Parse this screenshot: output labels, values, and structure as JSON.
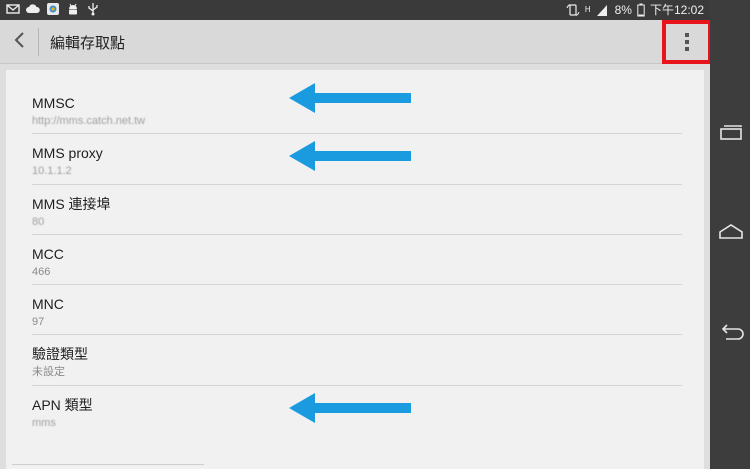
{
  "status_bar": {
    "battery": "8%",
    "clock": "下午12:02",
    "network_indicator": "H",
    "icons": [
      "gmail-icon",
      "cloud-icon",
      "app-icon",
      "android-icon",
      "usb-icon",
      "rotate-lock-icon",
      "signal-icon",
      "battery-icon"
    ]
  },
  "action_bar": {
    "title": "編輯存取點",
    "back_icon": "chevron-left-icon",
    "overflow_icon": "more-vertical-icon",
    "highlight_color": "#e8141c"
  },
  "fields": [
    {
      "title": "MMSC",
      "value": "http://mms.catch.net.tw",
      "arrow": true
    },
    {
      "title": "MMS proxy",
      "value": "10.1.1.2",
      "arrow": true
    },
    {
      "title": "MMS 連接埠",
      "value": "80",
      "arrow": false
    },
    {
      "title": "MCC",
      "value": "466",
      "arrow": false
    },
    {
      "title": "MNC",
      "value": "97",
      "arrow": false
    },
    {
      "title": "驗證類型",
      "value": "未設定",
      "arrow": false
    },
    {
      "title": "APN 類型",
      "value": "mms",
      "arrow": true
    }
  ],
  "annotation": {
    "arrow_color": "#1a9be0"
  },
  "nav_bar": {
    "buttons": [
      "recent-apps-icon",
      "home-icon",
      "back-icon"
    ]
  }
}
